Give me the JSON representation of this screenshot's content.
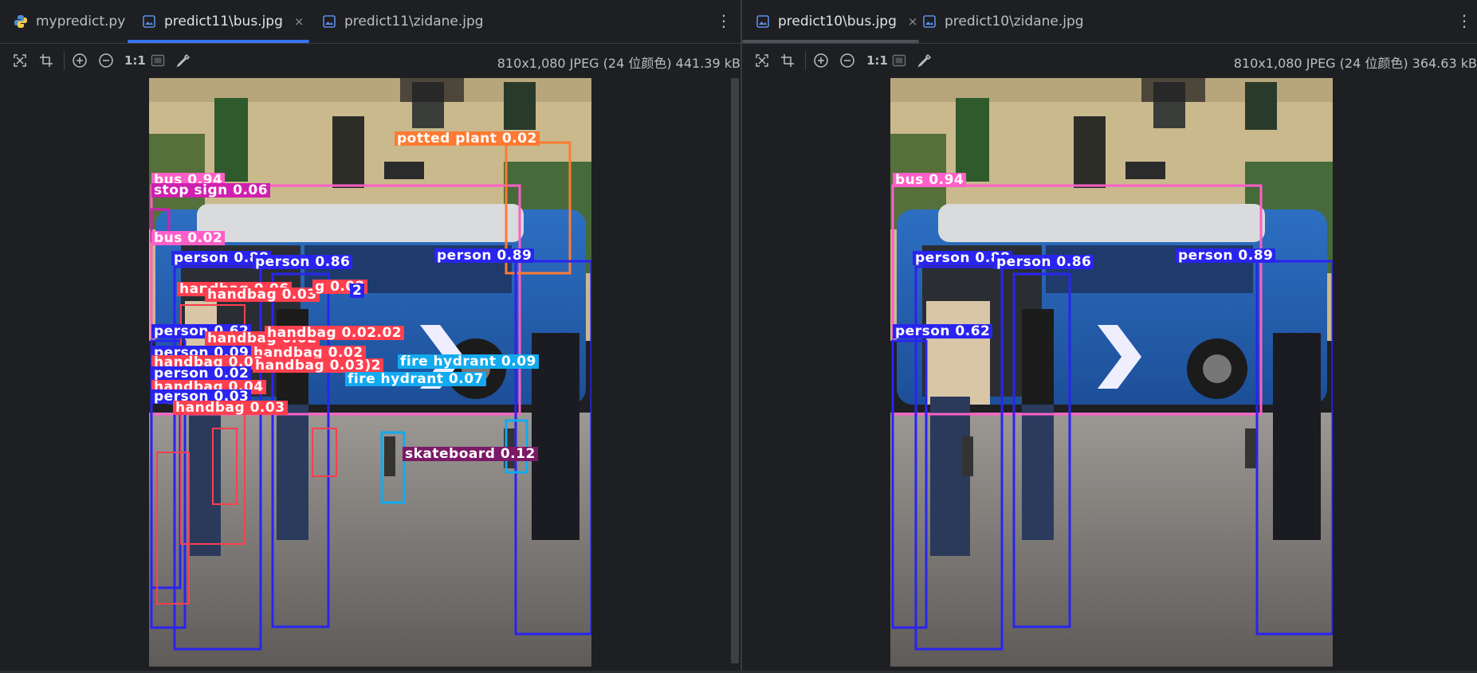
{
  "colors": {
    "accent": "#3574f0",
    "person": "#2a24f0",
    "bus": "#ff5fc8",
    "handbag": "#ff3f4f",
    "hydrant": "#12aaf0",
    "plant": "#ff7a32",
    "skateboard": "#7a1a66",
    "stopsign": "#d020b0",
    "yellow": "#e8e020"
  },
  "left": {
    "tabs": [
      {
        "label": "mypredict.py",
        "icon": "python-file-icon",
        "active": false
      },
      {
        "label": "predict11\\bus.jpg",
        "icon": "image-file-icon",
        "active": true,
        "close": "×"
      },
      {
        "label": "predict11\\zidane.jpg",
        "icon": "image-file-icon",
        "active": false
      }
    ],
    "menu": "⋮",
    "toolbar": {
      "zoom_label": "1:1"
    },
    "image_info": "810x1,080 JPEG (24 位颜色) 441.39 kB",
    "detections": [
      {
        "label": "bus 0.94",
        "color": "bus"
      },
      {
        "label": "stop sign 0.06",
        "color": "stopsign"
      },
      {
        "label": "bus 0.02",
        "color": "bus"
      },
      {
        "label": "potted plant 0.02",
        "color": "plant"
      },
      {
        "label": "person 0.88",
        "color": "person"
      },
      {
        "label": "person 0.86",
        "color": "person"
      },
      {
        "label": "person 0.89",
        "color": "person"
      },
      {
        "label": "handbag 0.06",
        "color": "handbag"
      },
      {
        "label": "handbag 0.03",
        "color": "handbag"
      },
      {
        "label": "g 0.02",
        "color": "handbag"
      },
      {
        "label": "2",
        "color": "person"
      },
      {
        "label": "person 0.62",
        "color": "person"
      },
      {
        "label": "handbag 0.02",
        "color": "handbag"
      },
      {
        "label": "handbag 0.02.02",
        "color": "handbag"
      },
      {
        "label": "person 0.09",
        "color": "person"
      },
      {
        "label": "handbag 0.02",
        "color": "handbag"
      },
      {
        "label": "handbag 0.03",
        "color": "handbag"
      },
      {
        "label": "handbag 0.03)2",
        "color": "handbag"
      },
      {
        "label": "fire hydrant 0.09",
        "color": "hydrant"
      },
      {
        "label": "person 0.02",
        "color": "person"
      },
      {
        "label": "fire hydrant 0.07",
        "color": "hydrant"
      },
      {
        "label": "handbag 0.04",
        "color": "handbag"
      },
      {
        "label": "person 0.03",
        "color": "person"
      },
      {
        "label": "handbag 0.03",
        "color": "handbag"
      },
      {
        "label": "skateboard 0.12",
        "color": "skateboard"
      }
    ]
  },
  "right": {
    "tabs": [
      {
        "label": "predict10\\bus.jpg",
        "icon": "image-file-icon",
        "active": true,
        "close": "×"
      },
      {
        "label": "predict10\\zidane.jpg",
        "icon": "image-file-icon",
        "active": false
      }
    ],
    "menu": "⋮",
    "toolbar": {
      "zoom_label": "1:1"
    },
    "image_info": "810x1,080 JPEG (24 位颜色) 364.63 kB",
    "detections": [
      {
        "label": "bus 0.94",
        "color": "bus"
      },
      {
        "label": "person 0.88",
        "color": "person"
      },
      {
        "label": "person 0.86",
        "color": "person"
      },
      {
        "label": "person 0.89",
        "color": "person"
      },
      {
        "label": "person 0.62",
        "color": "person"
      }
    ]
  }
}
